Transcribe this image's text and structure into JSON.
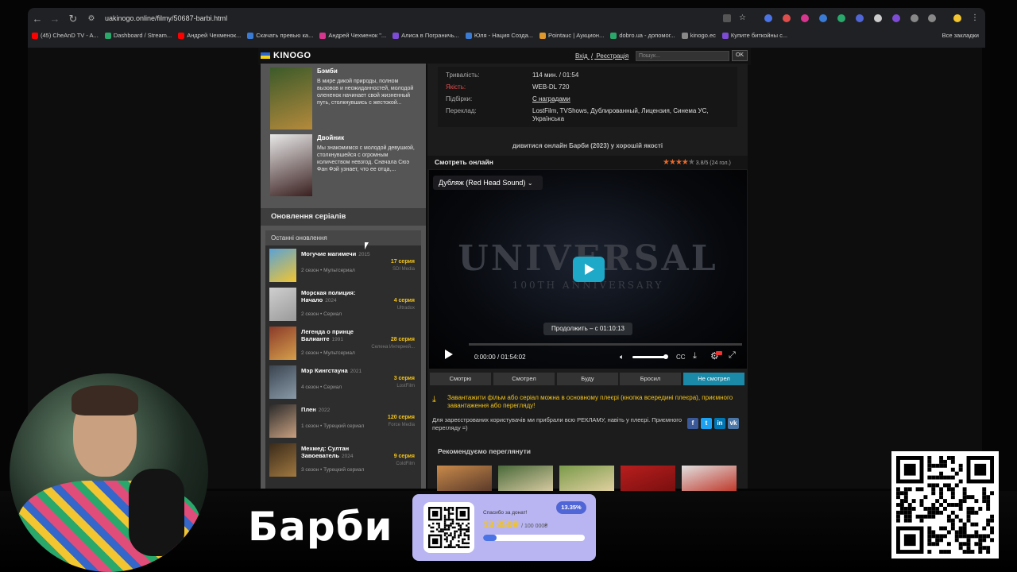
{
  "browser": {
    "url": "uakinogo.online/filmy/50687-barbi.html",
    "bookmarks": [
      {
        "label": "(45) CheAnD TV - A...",
        "color": "#ff0000"
      },
      {
        "label": "Dashboard / Stream...",
        "color": "#2aa86b"
      },
      {
        "label": "Андрей Чехменок...",
        "color": "#ff0000"
      },
      {
        "label": "Скачать превью ка...",
        "color": "#3a7bd5"
      },
      {
        "label": "Андрей Чехменок \"...",
        "color": "#d6368e"
      },
      {
        "label": "Алиса в Пограничь...",
        "color": "#7d4bd6"
      },
      {
        "label": "Юля - Нация Созда...",
        "color": "#3a7bd5"
      },
      {
        "label": "Pointauc | Аукцион...",
        "color": "#e0972b"
      },
      {
        "label": "dobro.ua - допомог...",
        "color": "#2aa86b"
      },
      {
        "label": "kinogo.ec",
        "color": "#888888"
      },
      {
        "label": "Купите биткойны с...",
        "color": "#7d4bd6"
      }
    ],
    "all_bookmarks": "Все закладки"
  },
  "site": {
    "logo": "KINOGO",
    "login": "Вхід",
    "register": "Реєстрація",
    "login_sep": "/",
    "search_placeholder": "Пошук...",
    "ok": "OK"
  },
  "sidebar": {
    "movies": [
      {
        "title": "Бэмби",
        "desc": "В мире дикой природы, полном вызовов и неожиданностей, молодой олененок начинает свой жизненный путь, столкнувшись с жестокой...",
        "poster_colors": [
          "#3b5a2a",
          "#b58a3c"
        ]
      },
      {
        "title": "Двойник",
        "desc": "Мы знакомимся с молодой девушкой, столкнувшейся с огромным количеством невзгод. Сначала Сюэ Фан Фэй узнает, что ее отца,...",
        "poster_colors": [
          "#e8e8e8",
          "#3a1f1f"
        ]
      }
    ],
    "series_heading": "Оновлення серіалів",
    "series_tab": "Останні оновлення",
    "series": [
      {
        "name": "Могучие магимечи",
        "year": "2015",
        "season": "2 сезон",
        "genre": "Мультсериал",
        "episode": "17 серия",
        "studio": "SDI Media",
        "thumb": [
          "#5aa2d6",
          "#f2c531"
        ]
      },
      {
        "name": "Морская полиция: Начало",
        "year": "2024",
        "season": "2 сезон",
        "genre": "Сериал",
        "episode": "4 серия",
        "studio": "Ultradox",
        "thumb": [
          "#cfcfcf",
          "#9a9a9a"
        ]
      },
      {
        "name": "Легенда о принце Валианте",
        "year": "1991",
        "season": "2 сезон",
        "genre": "Мультсериал",
        "episode": "28 серия",
        "studio": "Селена Интерней...",
        "thumb": [
          "#8a3a2a",
          "#d6a04b"
        ]
      },
      {
        "name": "Мэр Кингстауна",
        "year": "2021",
        "season": "4 сезон",
        "genre": "Сериал",
        "episode": "3 серия",
        "studio": "LostFilm",
        "thumb": [
          "#3a4450",
          "#8a9aa8"
        ]
      },
      {
        "name": "Плен",
        "year": "2022",
        "season": "1 сезон",
        "genre": "Турецкий сериал",
        "episode": "120 серия",
        "studio": "Force Media",
        "thumb": [
          "#2a2a2a",
          "#c9a080"
        ]
      },
      {
        "name": "Мехмед: Султан Завоеватель",
        "year": "2024",
        "season": "3 сезон",
        "genre": "Турецкий сериал",
        "episode": "9 серия",
        "studio": "ColdFilm",
        "thumb": [
          "#3a2a1a",
          "#a07840"
        ]
      }
    ]
  },
  "film_info": {
    "rows": [
      {
        "label": "Тривалість:",
        "value": "114 мин. / 01:54",
        "label_color": "#aaaaaa"
      },
      {
        "label": "Якість:",
        "value": "WEB-DL 720",
        "label_color": "#e04d4d"
      },
      {
        "label": "Підбірки:",
        "value": "С наградами",
        "label_color": "#aaaaaa"
      },
      {
        "label": "Переклад:",
        "value": "LostFilm, TVShows, Дублированный, Лицензия, Синема УС, Українська",
        "label_color": "#aaaaaa"
      }
    ],
    "watch_title": "дивитися онлайн Барби (2023) у хорошій якості"
  },
  "player": {
    "online_label": "Смотреть онлайн",
    "rating": "3.8/5 (24 гол.)",
    "stars": 4,
    "dub": "Дубляж (Red Head Sound)",
    "logo_text": "UNIVERSAL",
    "logo_sub": "100TH ANNIVERSARY",
    "resume": "Продолжить – с 01:10:13",
    "time_current": "0:00:00",
    "time_sep": "/",
    "time_total": "01:54:02",
    "cc": "CC"
  },
  "status_tabs": [
    {
      "label": "Смотрю",
      "active": false
    },
    {
      "label": "Смотрел",
      "active": false
    },
    {
      "label": "Буду",
      "active": false
    },
    {
      "label": "Бросил",
      "active": false
    },
    {
      "label": "Не смотрел",
      "active": true
    }
  ],
  "notice": "Завантажити фільм або серіал можна в основному плеєрі (кнопка всередині плеєра), приємного завантаження або перегляду!",
  "ads_text": "Для зареєстрованих користувачів ми прибрали всю РЕКЛАМУ, навіть у плеєрі. Приємного перегляду =)",
  "social": [
    {
      "label": "f",
      "color": "#3b5998"
    },
    {
      "label": "t",
      "color": "#1da1f2"
    },
    {
      "label": "in",
      "color": "#0077b5"
    },
    {
      "label": "vk",
      "color": "#4a76a8"
    }
  ],
  "recommend": {
    "heading": "Рекомендуємо переглянути",
    "items": [
      {
        "colors": [
          "#c98a4a",
          "#5a3a2a"
        ]
      },
      {
        "colors": [
          "#4a6a3a",
          "#d6c9a0"
        ]
      },
      {
        "colors": [
          "#7a9a4a",
          "#e0d0a0"
        ]
      },
      {
        "colors": [
          "#b81e1e",
          "#7a0f0f"
        ]
      },
      {
        "colors": [
          "#e0e0e0",
          "#c0392b"
        ]
      }
    ]
  },
  "overlay": {
    "show_title": "Барби",
    "donation_thanks": "Спасибо за донат!",
    "donation_amount": "13 350₴",
    "donation_goal": "/ 100 000₴",
    "donation_percent": "13.35%",
    "donation_progress": 0.1335
  }
}
